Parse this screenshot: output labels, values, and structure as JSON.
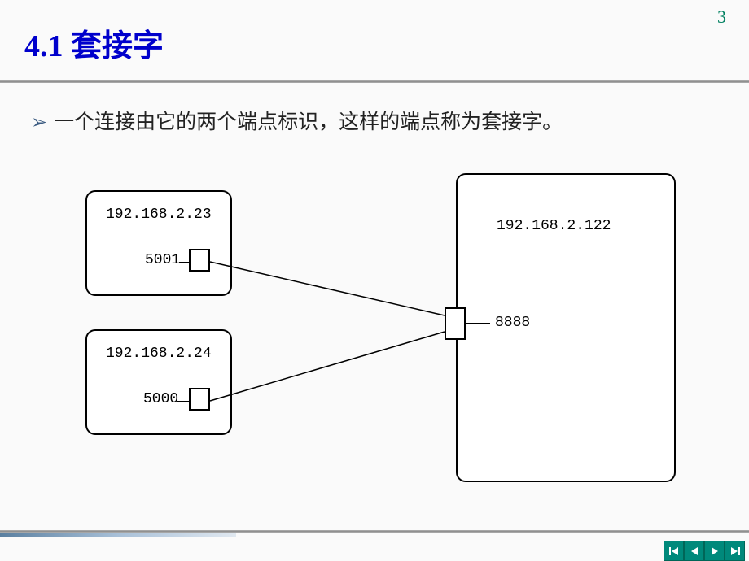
{
  "page_number": "3",
  "heading": "4.1 套接字",
  "bullet": {
    "marker": "➢",
    "text": "一个连接由它的两个端点标识，这样的端点称为套接字。"
  },
  "diagram": {
    "host1": {
      "ip": "192.168.2.23",
      "port": "5001"
    },
    "host2": {
      "ip": "192.168.2.24",
      "port": "5000"
    },
    "server": {
      "ip": "192.168.2.122",
      "port": "8888"
    }
  },
  "nav": {
    "first": "|◀",
    "prev": "◀",
    "next": "▶",
    "last": "▶|"
  }
}
